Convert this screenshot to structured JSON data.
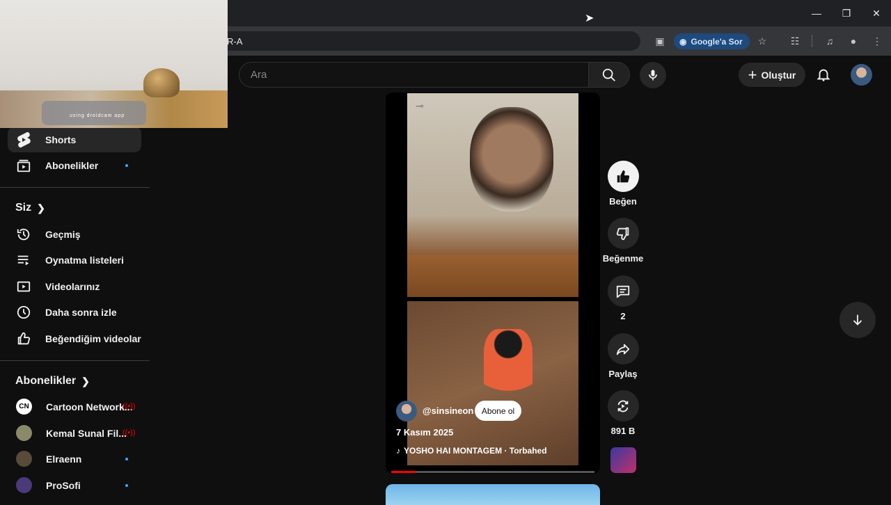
{
  "browser": {
    "url_fragment": "R-A",
    "google_lens_label": "Google'a Sor"
  },
  "header": {
    "search_placeholder": "Ara",
    "create_label": "Oluştur"
  },
  "sidebar": {
    "top_items": [
      {
        "label": "Shorts",
        "icon": "shorts-icon",
        "active": true
      },
      {
        "label": "Abonelikler",
        "icon": "subscriptions-icon",
        "badge": "dot"
      }
    ],
    "you_section_title": "Siz",
    "you_items": [
      {
        "label": "Geçmiş",
        "icon": "history-icon"
      },
      {
        "label": "Oynatma listeleri",
        "icon": "playlist-icon"
      },
      {
        "label": "Videolarınız",
        "icon": "your-videos-icon"
      },
      {
        "label": "Daha sonra izle",
        "icon": "watch-later-icon"
      },
      {
        "label": "Beğendiğim videolar",
        "icon": "liked-icon"
      }
    ],
    "subs_section_title": "Abonelikler",
    "subscriptions": [
      {
        "name": "Cartoon Network...",
        "status": "live",
        "avatar_color": "#ffffff"
      },
      {
        "name": "Kemal Sunal Fil...",
        "status": "live",
        "avatar_color": "#8a8a6a"
      },
      {
        "name": "Elraenn",
        "status": "dot",
        "avatar_color": "#5a4a3a"
      },
      {
        "name": "ProSofi",
        "status": "dot",
        "avatar_color": "#4a3a7a"
      }
    ]
  },
  "webcam": {
    "caption": "using droidcam app"
  },
  "short": {
    "channel": "@sinsineon",
    "subscribe_label": "Abone ol",
    "date": "7 Kasım 2025",
    "music": "YOSHO HAI MONTAGEM · Torbahed",
    "progress_fraction": 0.12
  },
  "actions": {
    "like_label": "Beğen",
    "dislike_label": "Beğenme",
    "comments_count": "2",
    "share_label": "Paylaş",
    "remix_count": "891 B"
  },
  "colors": {
    "background": "#0f0f0f",
    "accent_red": "#ff0000",
    "accent_blue": "#3ea6ff"
  }
}
